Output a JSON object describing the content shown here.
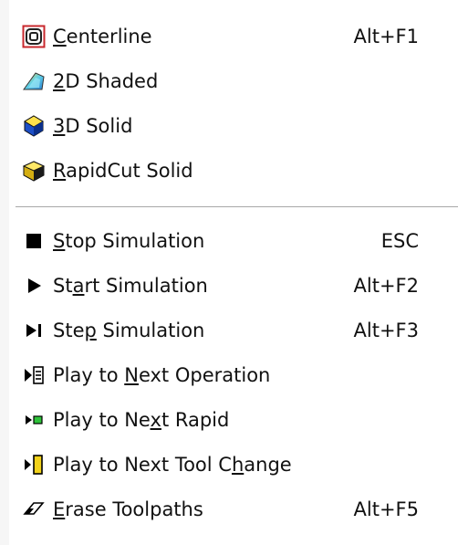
{
  "menu": {
    "items": [
      {
        "label": "Centerline",
        "accel_index": 0,
        "shortcut": "Alt+F1",
        "icon": "centerline-icon"
      },
      {
        "label": "2D Shaded",
        "accel_index": 0,
        "shortcut": "",
        "icon": "shaded-2d-icon"
      },
      {
        "label": "3D Solid",
        "accel_index": 0,
        "shortcut": "",
        "icon": "solid-3d-icon"
      },
      {
        "label": "RapidCut Solid",
        "accel_index": 0,
        "shortcut": "",
        "icon": "rapidcut-solid-icon"
      },
      {
        "label": "Stop Simulation",
        "accel_index": 0,
        "shortcut": "ESC",
        "icon": "stop-icon"
      },
      {
        "label": "Start Simulation",
        "accel_index": 2,
        "shortcut": "Alt+F2",
        "icon": "play-icon"
      },
      {
        "label": "Step Simulation",
        "accel_index": 3,
        "shortcut": "Alt+F3",
        "icon": "step-icon"
      },
      {
        "label": "Play to Next Operation",
        "accel_index": 8,
        "shortcut": "",
        "icon": "next-operation-icon"
      },
      {
        "label": "Play to Next Rapid",
        "accel_index": 10,
        "shortcut": "",
        "icon": "next-rapid-icon"
      },
      {
        "label": "Play to Next Tool Change",
        "accel_index": 19,
        "shortcut": "",
        "icon": "next-tool-change-icon"
      },
      {
        "label": "Erase Toolpaths",
        "accel_index": 0,
        "shortcut": "Alt+F5",
        "icon": "eraser-icon"
      }
    ]
  }
}
